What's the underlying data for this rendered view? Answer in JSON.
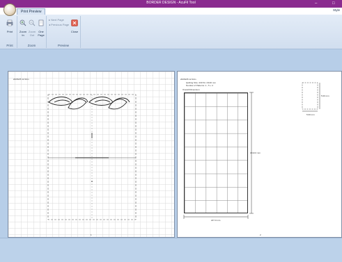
{
  "window": {
    "title": "BORDER DESIGN - AcuFil Tool",
    "minimize_glyph": "–",
    "maximize_glyph": "□",
    "style_label": "Style"
  },
  "tabs": [
    {
      "label": "Print Preview",
      "active": true
    }
  ],
  "ribbon": {
    "groups": [
      {
        "label": "Print",
        "buttons": [
          {
            "label": "Print",
            "icon": "printer-icon"
          }
        ]
      },
      {
        "label": "Zoom",
        "buttons": [
          {
            "label": "Zoom In",
            "icon": "zoom-in-icon"
          },
          {
            "label": "Zoom Out",
            "icon": "zoom-out-icon"
          },
          {
            "label": "One Page",
            "icon": "one-page-icon"
          }
        ]
      },
      {
        "label": "Preview",
        "buttons": [
          {
            "label": "Next Page",
            "icon": "next-page-icon",
            "enabled": false
          },
          {
            "label": "Previous Page",
            "icon": "previous-page-icon",
            "enabled": false
          },
          {
            "label": "Close",
            "icon": "close-icon"
          }
        ]
      }
    ]
  },
  "pages": {
    "left": {
      "header": "20/06/25 12:34m",
      "page_number": "1"
    },
    "right": {
      "header": "20/06/25 12:34m",
      "info_line1": "Quilting Size: 230 W x 6130 mm",
      "info_line2": "Number of Patterns: 1 - 5 + 4",
      "overall_label": "Overall Dimension",
      "height_label": "1813.0 mm",
      "width_label": "227.0 mm",
      "small_height_label": "5.00 mm",
      "small_width_label": "5.00 mm",
      "page_number": "2"
    }
  },
  "colors": {
    "title_bar": "#8a2b8f",
    "ribbon": "#dbe6f4",
    "background": "#b7cee8",
    "close_button": "#e06050"
  }
}
